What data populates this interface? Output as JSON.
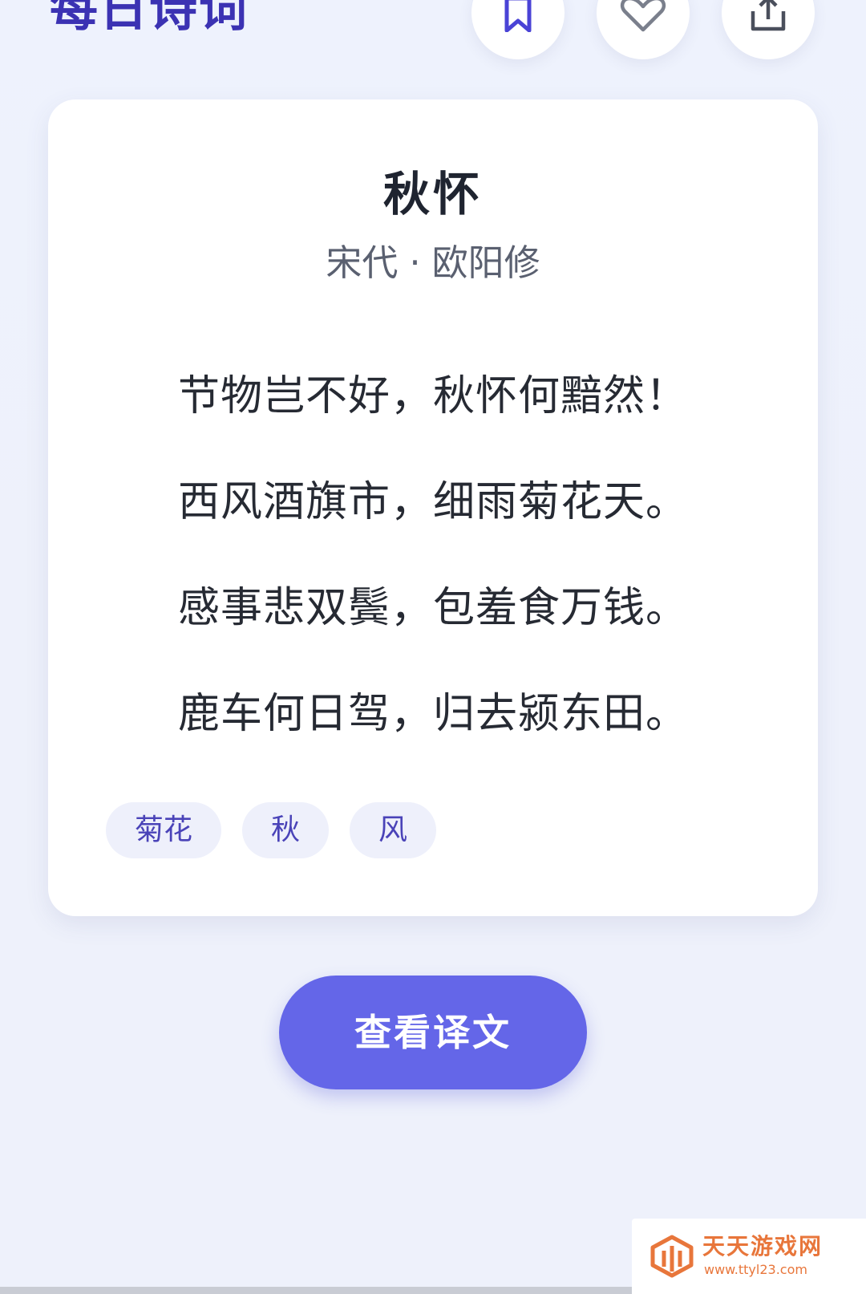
{
  "header": {
    "title": "每日诗词",
    "actions": [
      {
        "icon": "bookmark-icon",
        "color": "#4a43d6"
      },
      {
        "icon": "heart-icon",
        "color": "#7a7f8c"
      },
      {
        "icon": "share-icon",
        "color": "#4a4f5c"
      }
    ]
  },
  "poem": {
    "title": "秋怀",
    "dynasty": "宋代",
    "separator": "·",
    "author": "欧阳修",
    "lines": [
      "节物岂不好，秋怀何黯然！",
      "西风酒旗市，细雨菊花天。",
      "感事悲双鬓，包羞食万钱。",
      "鹿车何日驾，归去颍东田。"
    ],
    "tags": [
      "菊花",
      "秋",
      "风"
    ]
  },
  "translate_button": {
    "label": "查看译文"
  },
  "watermark": {
    "name": "天天游戏网",
    "url": "www.ttyl23.com"
  },
  "colors": {
    "accent": "#6466e8",
    "title": "#3b32b3",
    "tag_text": "#4a43b8",
    "tag_bg": "#eef0fb"
  }
}
